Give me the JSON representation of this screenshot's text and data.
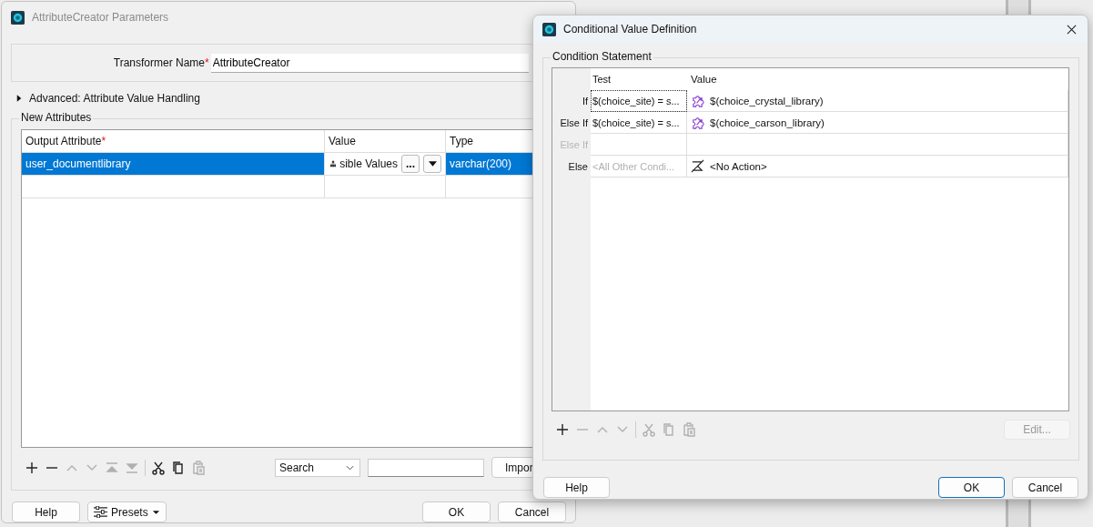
{
  "attribute_creator": {
    "title": "AttributeCreator Parameters",
    "transformer_name": {
      "label": "Transformer Name",
      "required_mark": "*",
      "value": "AttributeCreator"
    },
    "advanced": {
      "label": "Advanced: Attribute Value Handling",
      "expanded": false
    },
    "new_attributes": {
      "title": "New Attributes",
      "columns": [
        {
          "label": "Output Attribute",
          "required_mark": "*"
        },
        {
          "label": "Value"
        },
        {
          "label": "Type"
        }
      ],
      "rows": [
        {
          "output_attribute": "user_documentlibrary",
          "value": "sible Values",
          "more": "...",
          "type": "varchar(200)",
          "selected": true
        }
      ],
      "toolbar": [
        {
          "kind": "add",
          "disabled": false
        },
        {
          "kind": "remove",
          "disabled": false
        },
        {
          "kind": "up",
          "disabled": true
        },
        {
          "kind": "down",
          "disabled": true
        },
        {
          "kind": "top",
          "disabled": true
        },
        {
          "kind": "bottom",
          "disabled": true
        },
        {
          "kind": "cut",
          "disabled": false
        },
        {
          "kind": "copy",
          "disabled": false
        },
        {
          "kind": "paste",
          "disabled": true
        }
      ],
      "search_mode": "Search",
      "import_button": "Impor"
    },
    "buttons": {
      "help": "Help",
      "presets": "Presets",
      "ok": "OK",
      "cancel": "Cancel"
    }
  },
  "conditional_value_definition": {
    "title": "Conditional Value Definition",
    "group_title": "Condition Statement",
    "columns": [
      "Test",
      "Value"
    ],
    "conditions": [
      {
        "label": "If",
        "disabled": false,
        "focused": true,
        "test": "$(choice_site) = s...",
        "value": "$(choice_crystal_library)",
        "kind": "expression"
      },
      {
        "label": "Else If",
        "disabled": false,
        "focused": false,
        "test": "$(choice_site) = s...",
        "value": "$(choice_carson_library)",
        "kind": "expression"
      },
      {
        "label": "Else If",
        "disabled": true,
        "focused": false
      },
      {
        "label": "Else",
        "disabled": false,
        "focused": false,
        "test_placeholder": "<All Other Condi...",
        "value": "<No Action>",
        "kind": "no_action"
      }
    ],
    "toolbar": [
      {
        "kind": "add",
        "disabled": false
      },
      {
        "kind": "remove",
        "disabled": true
      },
      {
        "kind": "up",
        "disabled": true
      },
      {
        "kind": "down",
        "disabled": true
      },
      {
        "kind": "cut",
        "disabled": true
      },
      {
        "kind": "copy",
        "disabled": true
      },
      {
        "kind": "paste",
        "disabled": true
      }
    ],
    "edit_button": {
      "label": "Edit...",
      "disabled": true
    },
    "buttons": {
      "help": "Help",
      "ok": "OK",
      "cancel": "Cancel"
    }
  }
}
